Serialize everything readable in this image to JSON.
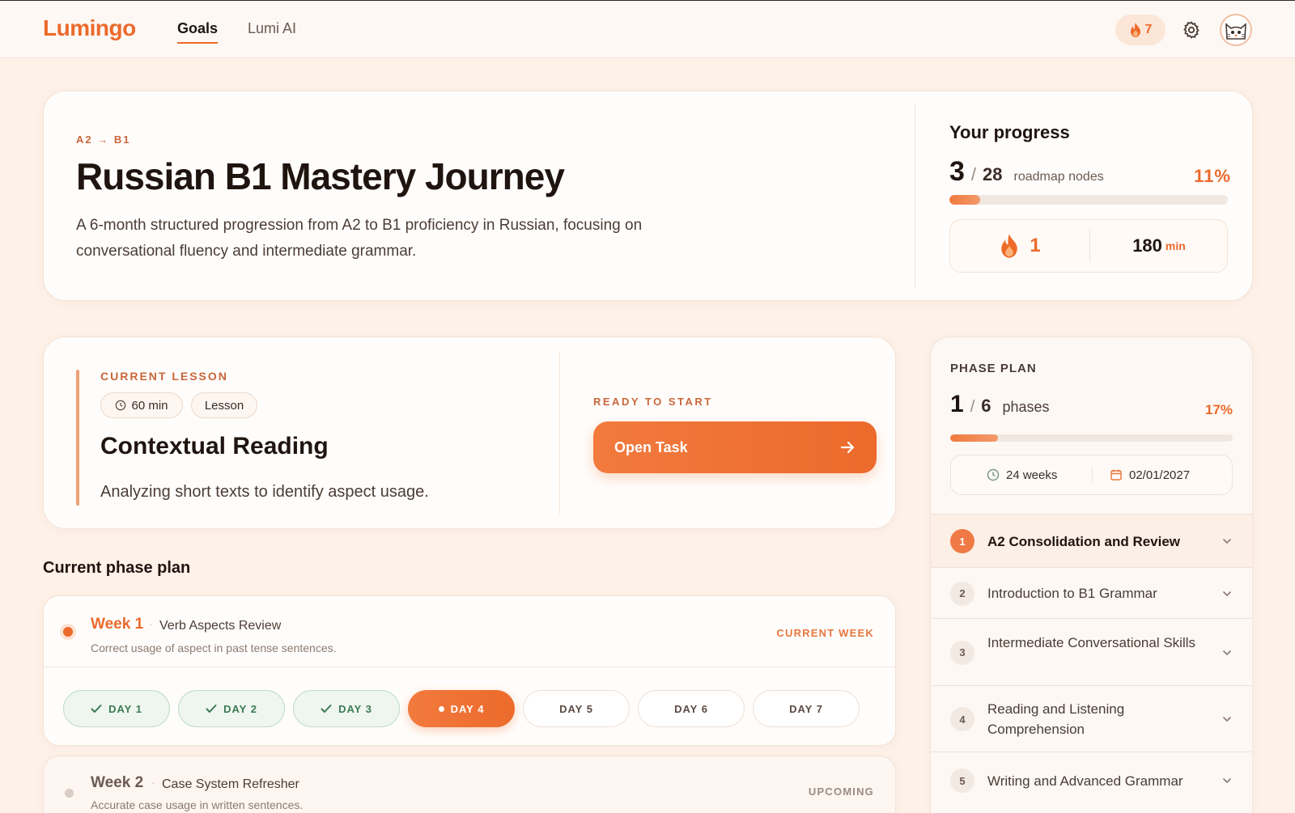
{
  "brand": {
    "name": "Lumingo",
    "accent": "#ec6a2c"
  },
  "nav": {
    "items": [
      "Goals",
      "Lumi AI"
    ],
    "active": "Goals"
  },
  "header": {
    "streak_count": "7"
  },
  "goal": {
    "level": "A2 → B1",
    "title": "Russian B1 Mastery Journey",
    "description": "A 6-month structured progression from A2 to B1 proficiency in Russian, focusing on conversational fluency and intermediate grammar."
  },
  "progress": {
    "title": "Your progress",
    "done": "3",
    "total": "28",
    "label": "roadmap nodes",
    "percent_label": "11%",
    "fraction": 0.11,
    "streak": "1",
    "minutes": "180",
    "minutes_unit": "min"
  },
  "lesson": {
    "tag": "CURRENT LESSON",
    "duration": "60 min",
    "type": "Lesson",
    "title": "Contextual Reading",
    "description": "Analyzing short texts to identify aspect usage.",
    "ready_label": "READY TO START",
    "open_button": "Open Task"
  },
  "phase_section_title": "Current phase plan",
  "weeks": [
    {
      "name": "Week 1",
      "topic": "Verb Aspects Review",
      "goal": "Correct usage of aspect in past tense sentences.",
      "status": "CURRENT WEEK",
      "days": [
        {
          "label": "DAY 1",
          "state": "done"
        },
        {
          "label": "DAY 2",
          "state": "done"
        },
        {
          "label": "DAY 3",
          "state": "done"
        },
        {
          "label": "DAY 4",
          "state": "current"
        },
        {
          "label": "DAY 5",
          "state": "future"
        },
        {
          "label": "DAY 6",
          "state": "future"
        },
        {
          "label": "DAY 7",
          "state": "future"
        }
      ]
    },
    {
      "name": "Week 2",
      "topic": "Case System Refresher",
      "goal": "Accurate case usage in written sentences.",
      "status": "UPCOMING"
    }
  ],
  "phase_plan": {
    "label": "PHASE PLAN",
    "done": "1",
    "total": "6",
    "unit": "phases",
    "percent_label": "17%",
    "fraction": 0.17,
    "duration": "24 weeks",
    "end_date": "02/01/2027",
    "phases": [
      {
        "num": "1",
        "name": "A2 Consolidation and Review",
        "active": true
      },
      {
        "num": "2",
        "name": "Introduction to B1 Grammar",
        "active": false
      },
      {
        "num": "3",
        "name": "Intermediate Conversational Skills",
        "active": false
      },
      {
        "num": "4",
        "name": "Reading and Listening Comprehension",
        "active": false
      },
      {
        "num": "5",
        "name": "Writing and Advanced Grammar",
        "active": false
      }
    ]
  },
  "icons": {
    "streak": "flame-icon",
    "settings": "gear-icon",
    "avatar": "cat-avatar-icon",
    "clock": "clock-icon",
    "calendar": "calendar-icon",
    "check": "check-icon",
    "arrow": "arrow-right-icon",
    "chevron": "chevron-down-icon"
  }
}
